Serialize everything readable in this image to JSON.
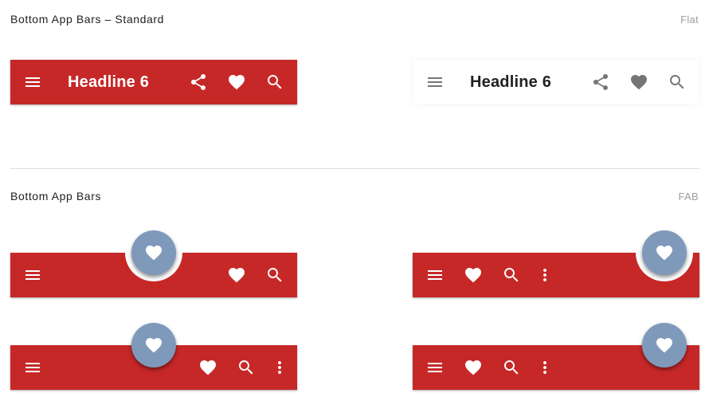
{
  "sections": {
    "standard_title": "Bottom App Bars – Standard",
    "standard_tag": "Flat",
    "fab_title": "Bottom App Bars",
    "fab_tag": "FAB"
  },
  "standard_bars": {
    "red_headline": "Headline 6",
    "white_headline": "Headline 6"
  },
  "colors": {
    "bar_red": "#c62828",
    "fab": "#7f99bb",
    "icon_on_white": "#757575"
  },
  "icons": [
    "menu-icon",
    "share-icon",
    "heart-icon",
    "search-icon",
    "more-vert-icon"
  ]
}
